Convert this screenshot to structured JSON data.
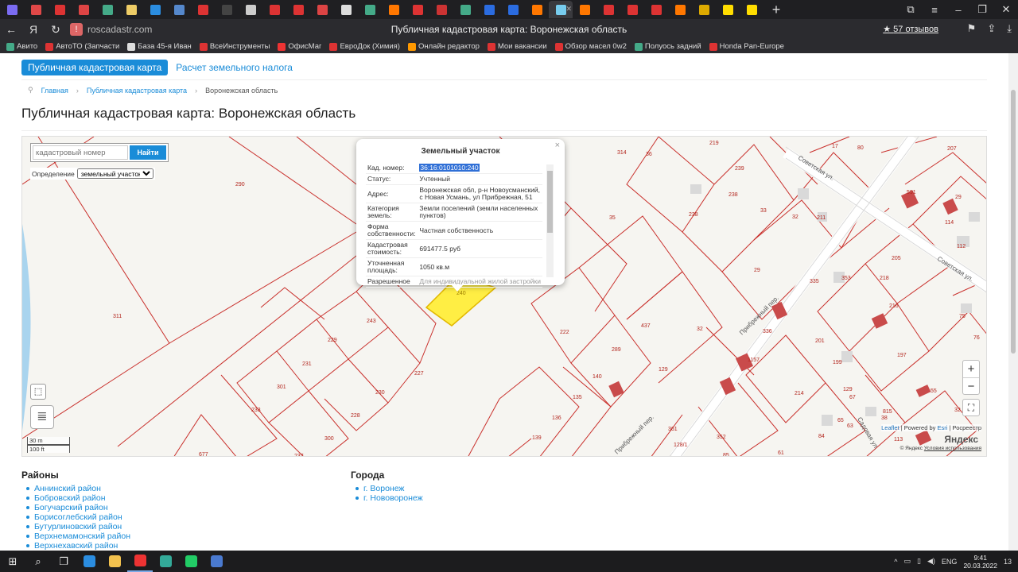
{
  "browser": {
    "page_title": "Публичная кадастровая карта: Воронежская область",
    "url_host": "roscadastr.com",
    "reviews": "57 отзывов",
    "tab_colors": [
      "#7b6cf2",
      "#e04848",
      "#d33",
      "#d44",
      "#4a8",
      "#ec6",
      "#2b8de0",
      "#58c",
      "#d33",
      "#444",
      "#ccc",
      "#d33",
      "#d33",
      "#d44",
      "#ddd",
      "#4a8",
      "#f70",
      "#d33",
      "#c33",
      "#4a8",
      "#2b6ce0",
      "#2b6ce0",
      "#f70",
      "#7ce",
      "#f70",
      "#d33",
      "#d33",
      "#d33",
      "#f70",
      "#da0",
      "#fd0",
      "#fd0"
    ],
    "bookmarks": [
      {
        "label": "Авито",
        "color": "#4a8"
      },
      {
        "label": "АвтоТО (Запчасти",
        "color": "#d33"
      },
      {
        "label": "База 45-я Иван",
        "color": "#ddd"
      },
      {
        "label": "ВсеИнструменты",
        "color": "#d33"
      },
      {
        "label": "ОфисМаг",
        "color": "#e33"
      },
      {
        "label": "ЕвроДок (Химия)",
        "color": "#d33"
      },
      {
        "label": "Онлайн редактор",
        "color": "#f90"
      },
      {
        "label": "Мои вакансии",
        "color": "#d33"
      },
      {
        "label": "Обзор масел 0w2",
        "color": "#d33"
      },
      {
        "label": "Полуось задний",
        "color": "#4a8"
      },
      {
        "label": "Honda Pan-Europe",
        "color": "#d33"
      }
    ]
  },
  "page": {
    "nav_active": "Публичная кадастровая карта",
    "nav_link": "Расчет земельного налога",
    "breadcrumbs": [
      "Главная",
      "Публичная кадастровая карта",
      "Воронежская область"
    ],
    "heading": "Публичная кадастровая карта: Воронежская область"
  },
  "map": {
    "search_placeholder": "кадастровый номер",
    "search_button": "Найти",
    "definition_label": "Определение",
    "definition_value": "земельный участок",
    "scale_m": "30 m",
    "scale_ft": "100 ft",
    "zoom_in": "+",
    "zoom_out": "−",
    "attribution_leaflet": "Leaflet",
    "attribution_rest": "| Powered by",
    "attribution_esri": "Esri",
    "attribution_rosreestr": "| Росреестр",
    "yandex": "Яндекс",
    "copyright": "© Яндекс",
    "terms": "Условия использования",
    "parcel_numbers": [
      {
        "t": "290"
      },
      {
        "t": "311"
      },
      {
        "t": "314"
      },
      {
        "t": "36"
      },
      {
        "t": "219"
      },
      {
        "t": "17"
      },
      {
        "t": "80"
      },
      {
        "t": "207"
      },
      {
        "t": "239"
      },
      {
        "t": "238"
      },
      {
        "t": "238"
      },
      {
        "t": "33"
      },
      {
        "t": "32"
      },
      {
        "t": "211"
      },
      {
        "t": "591"
      },
      {
        "t": "29"
      },
      {
        "t": "114"
      },
      {
        "t": "112"
      },
      {
        "t": "35"
      },
      {
        "t": "29"
      },
      {
        "t": "335"
      },
      {
        "t": "353"
      },
      {
        "t": "218"
      },
      {
        "t": "205"
      },
      {
        "t": "216"
      },
      {
        "t": "243"
      },
      {
        "t": "229"
      },
      {
        "t": "231"
      },
      {
        "t": "301"
      },
      {
        "t": "233"
      },
      {
        "t": "230"
      },
      {
        "t": "227"
      },
      {
        "t": "228"
      },
      {
        "t": "300"
      },
      {
        "t": "237"
      },
      {
        "t": "677"
      },
      {
        "t": "222"
      },
      {
        "t": "437"
      },
      {
        "t": "289"
      },
      {
        "t": "140"
      },
      {
        "t": "135"
      },
      {
        "t": "129"
      },
      {
        "t": "136"
      },
      {
        "t": "139"
      },
      {
        "t": "32"
      },
      {
        "t": "336"
      },
      {
        "t": "201"
      },
      {
        "t": "199"
      },
      {
        "t": "197"
      },
      {
        "t": "75"
      },
      {
        "t": "76"
      },
      {
        "t": "1157"
      },
      {
        "t": "214"
      },
      {
        "t": "129"
      },
      {
        "t": "67"
      },
      {
        "t": "65"
      },
      {
        "t": "63"
      },
      {
        "t": "84"
      },
      {
        "t": "815"
      },
      {
        "t": "38"
      },
      {
        "t": "32"
      },
      {
        "t": "55"
      },
      {
        "t": "361"
      },
      {
        "t": "128/1"
      },
      {
        "t": "352"
      },
      {
        "t": "85"
      },
      {
        "t": "61"
      },
      {
        "t": "113"
      }
    ],
    "street_labels": [
      {
        "t": "Советская ул."
      },
      {
        "t": "Советская ул."
      },
      {
        "t": "Прибрежный пер."
      },
      {
        "t": "Садовая ул."
      },
      {
        "t": "Прибрежный пер."
      }
    ]
  },
  "popup": {
    "title": "Земельный участок",
    "close": "×",
    "rows": [
      {
        "key": "Кад. номер:",
        "value": "36:16:0101010:240"
      },
      {
        "key": "Статус:",
        "value": "Учтенный"
      },
      {
        "key": "Адрес:",
        "value": "Воронежская обл, р-н Новоусманский, с Новая Усмань, ул Прибрежная, 51"
      },
      {
        "key": "Категория земель:",
        "value": "Земли поселений (земли населенных пунктов)"
      },
      {
        "key": "Форма собственности:",
        "value": "Частная собственность"
      },
      {
        "key": "Кадастровая стоимость:",
        "value": "691477.5 руб"
      },
      {
        "key": "Уточненная площадь:",
        "value": "1050 кв.м"
      },
      {
        "key": "Разрешенное",
        "value": "Для индивидуальной жилой застройки"
      }
    ]
  },
  "footer": {
    "districts_title": "Районы",
    "districts": [
      "Аннинский район",
      "Бобровский район",
      "Богучарский район",
      "Борисоглебский район",
      "Бутурлиновский район",
      "Верхнемамонский район",
      "Верхнехавский район"
    ],
    "cities_title": "Города",
    "cities": [
      "г. Воронеж",
      "г. Нововоронеж"
    ]
  },
  "taskbar": {
    "lang": "ENG",
    "time": "9:41",
    "date": "20.03.2022",
    "notif": "13",
    "apps": [
      {
        "name": "mail",
        "color": "#2b8de0"
      },
      {
        "name": "explorer",
        "color": "#f2c14e"
      },
      {
        "name": "yandex",
        "color": "#e33"
      },
      {
        "name": "edge",
        "color": "#3a9"
      },
      {
        "name": "whatsapp",
        "color": "#2c6"
      },
      {
        "name": "calc",
        "color": "#4a7ad0"
      }
    ]
  }
}
